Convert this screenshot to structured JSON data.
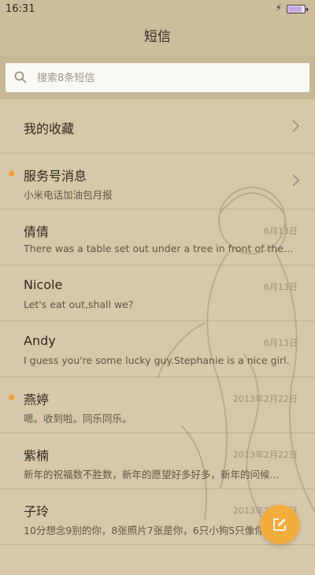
{
  "status_bar": {
    "time": "16:31",
    "charging_icon": "lightning-icon",
    "battery_level": 0.85
  },
  "header": {
    "title": "短信"
  },
  "search": {
    "placeholder": "搜索8条短信",
    "icon": "search-icon"
  },
  "favorites": {
    "label": "我的收藏",
    "icon": "chevron-right-icon"
  },
  "conversations": [
    {
      "name": "服务号消息",
      "preview": "小米电话加油包月报",
      "date": "",
      "unread": true,
      "chevron": true
    },
    {
      "name": "倩倩",
      "preview": "There was a table set out under a tree in front of the ho...",
      "date": "6月13日",
      "unread": false
    },
    {
      "name": "Nicole",
      "preview": "Let's eat out,shall we?",
      "date": "6月13日",
      "unread": false
    },
    {
      "name": "Andy",
      "preview": "I guess you're some lucky guy.Stephanie is a nice girl.",
      "date": "6月13日",
      "unread": false
    },
    {
      "name": "燕婷",
      "preview": "嗯。收到啦。同乐同乐。",
      "date": "2013年2月22日",
      "unread": true
    },
    {
      "name": "紫楠",
      "preview": "新年的祝福数不胜数，新年的愿望好多好多，新年的问候...",
      "date": "2013年2月22日",
      "unread": false
    },
    {
      "name": "子玲",
      "preview": "10分想念9别的你，8张照片7张是你，6只小狗5只像你...",
      "date": "2013年2月22日",
      "unread": false
    }
  ],
  "fab": {
    "icon": "compose-icon"
  },
  "colors": {
    "accent": "#f3ad3c",
    "unread_dot": "#f0a030",
    "background": "#d6c8a8"
  }
}
